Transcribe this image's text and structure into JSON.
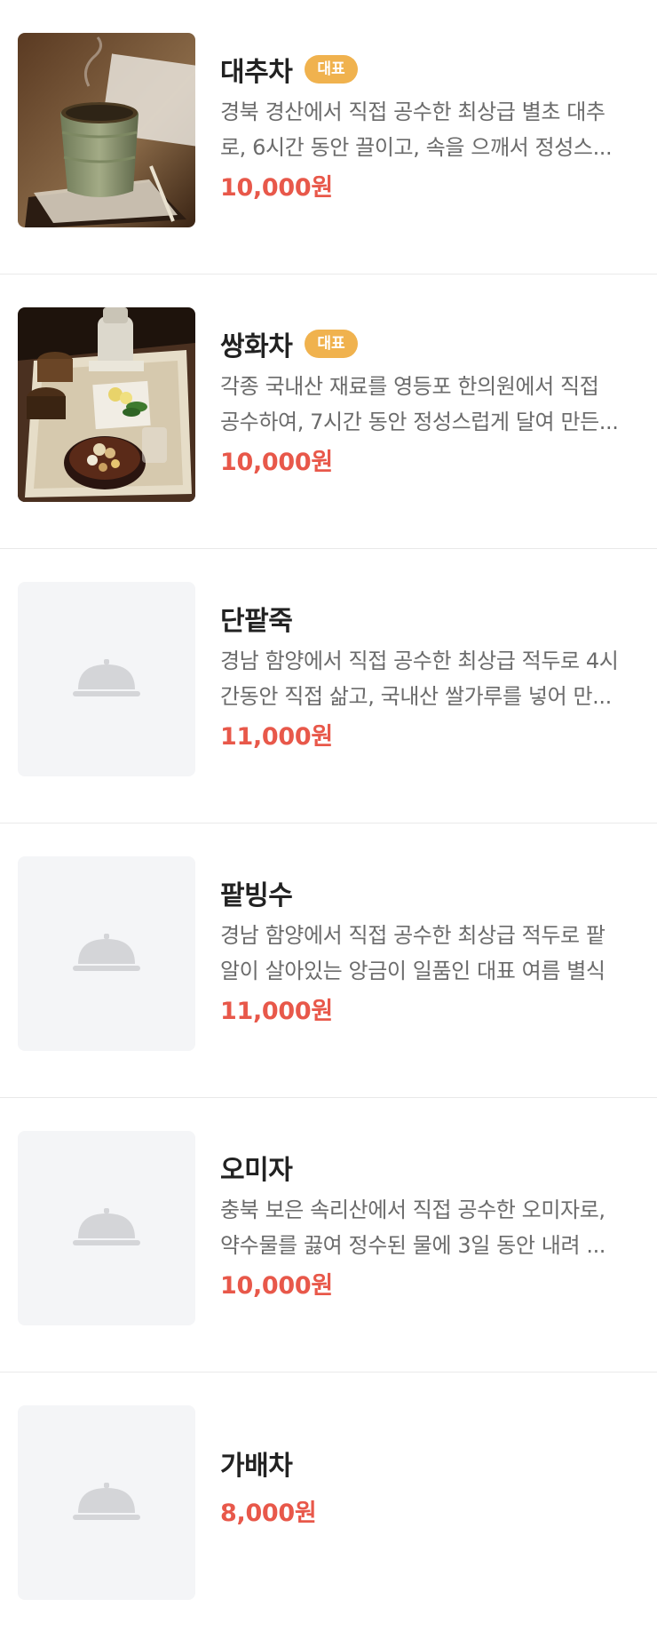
{
  "menu_items": [
    {
      "name": "대추차",
      "badge": "대표",
      "desc_line1": "경북 경산에서 직접 공수한 최상급 별초 대추",
      "desc_line2": "로, 6시간 동안 끌이고, 속을 으깨서 정성스...",
      "price": "10,000원",
      "image": "jujube-tea-photo"
    },
    {
      "name": "쌍화차",
      "badge": "대표",
      "desc_line1": "각종 국내산 재료를 영등포 한의원에서 직접",
      "desc_line2": "공수하여, 7시간 동안 정성스럽게 달여 만든...",
      "price": "10,000원",
      "image": "ssanghwa-tea-photo"
    },
    {
      "name": "단팥죽",
      "desc_line1": "경남 함양에서 직접 공수한 최상급 적두로 4시",
      "desc_line2": "간동안 직접 삶고, 국내산 쌀가루를 넣어 만...",
      "price": "11,000원",
      "image": "cloche-icon"
    },
    {
      "name": "팥빙수",
      "desc_line1": "경남 함양에서 직접 공수한 최상급 적두로 팥",
      "desc_line2": "알이 살아있는 앙금이 일품인 대표 여름 별식",
      "price": "11,000원",
      "image": "cloche-icon"
    },
    {
      "name": "오미자",
      "desc_line1": "충북 보은 속리산에서 직접 공수한 오미자로,",
      "desc_line2": "약수물를 끓여 정수된 물에 3일 동안 내려 ...",
      "price": "10,000원",
      "image": "cloche-icon"
    },
    {
      "name": "가배차",
      "price": "8,000원",
      "image": "cloche-icon"
    }
  ],
  "colors": {
    "price": "#e8584a",
    "badge": "#f0b24e",
    "placeholder_bg": "#f4f5f7",
    "placeholder_icon": "#d4d5d8"
  }
}
